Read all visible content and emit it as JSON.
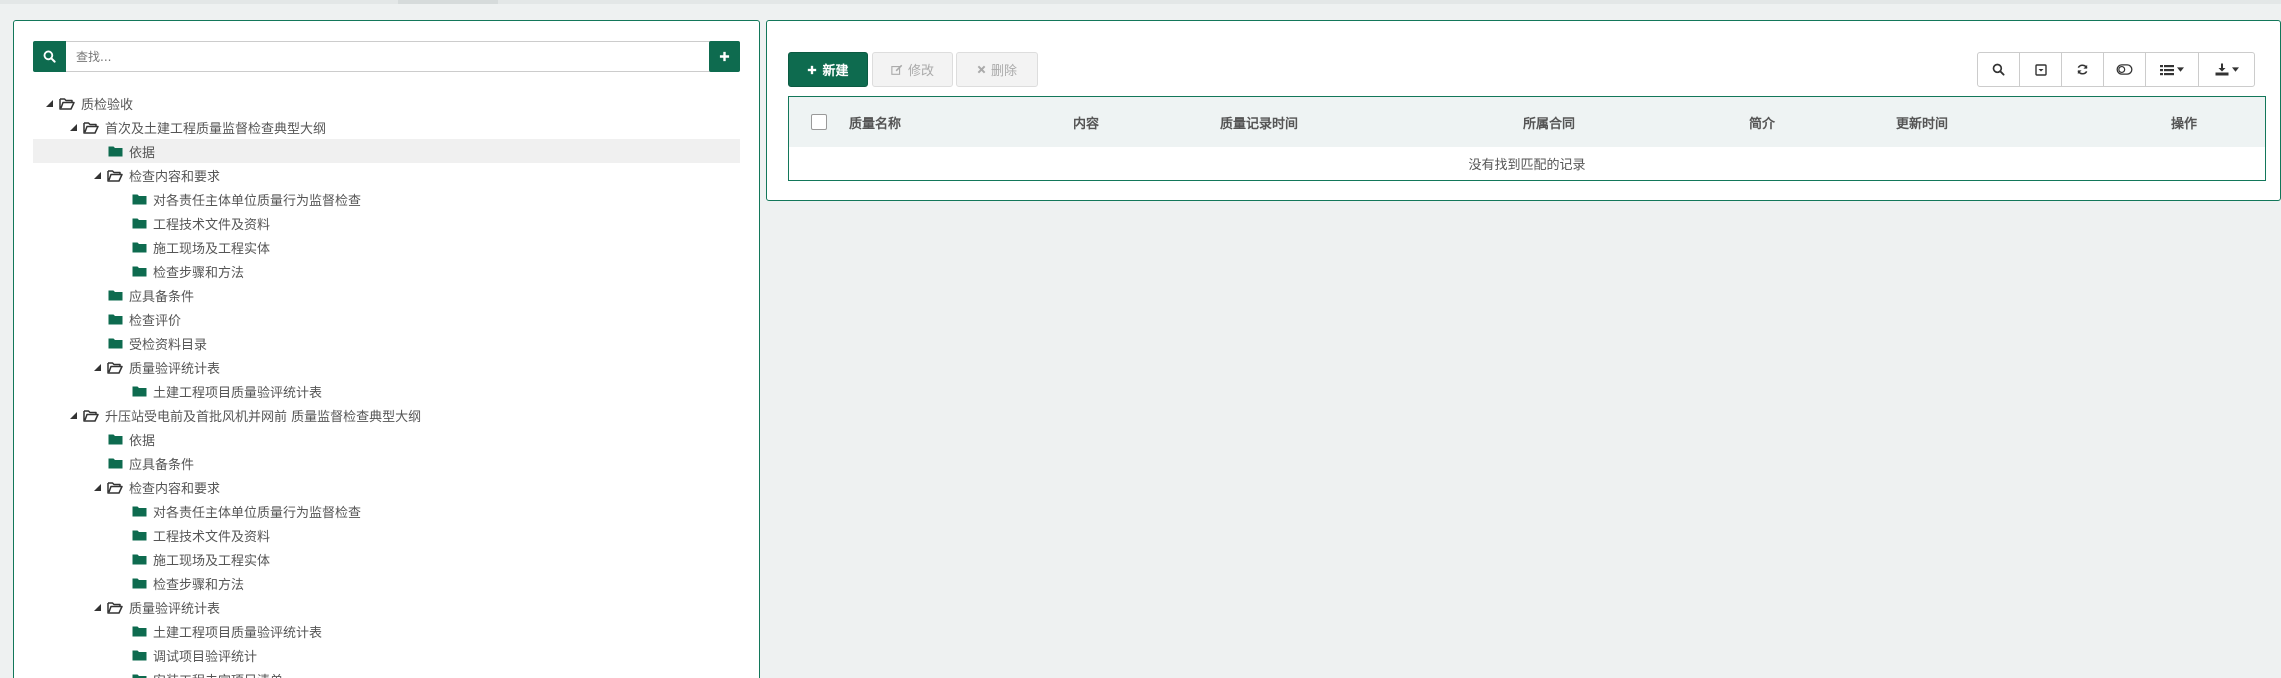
{
  "search": {
    "placeholder": "查找..."
  },
  "tree": [
    {
      "label": "质检验收",
      "level": 0,
      "caret": true,
      "open": true
    },
    {
      "label": "首次及土建工程质量监督检查典型大纲",
      "level": 1,
      "caret": true,
      "open": true
    },
    {
      "label": "依据",
      "level": 2,
      "caret": false,
      "open": false,
      "selected": true
    },
    {
      "label": "检查内容和要求",
      "level": 2,
      "caret": true,
      "open": true
    },
    {
      "label": "对各责任主体单位质量行为监督检查",
      "level": 3,
      "caret": false,
      "open": false
    },
    {
      "label": "工程技术文件及资料",
      "level": 3,
      "caret": false,
      "open": false
    },
    {
      "label": "施工现场及工程实体",
      "level": 3,
      "caret": false,
      "open": false
    },
    {
      "label": "检查步骤和方法",
      "level": 3,
      "caret": false,
      "open": false
    },
    {
      "label": "应具备条件",
      "level": 2,
      "caret": false,
      "open": false
    },
    {
      "label": "检查评价",
      "level": 2,
      "caret": false,
      "open": false
    },
    {
      "label": "受检资料目录",
      "level": 2,
      "caret": false,
      "open": false
    },
    {
      "label": "质量验评统计表",
      "level": 2,
      "caret": true,
      "open": true
    },
    {
      "label": "土建工程项目质量验评统计表",
      "level": 3,
      "caret": false,
      "open": false
    },
    {
      "label": "升压站受电前及首批风机并网前 质量监督检查典型大纲",
      "level": 1,
      "caret": true,
      "open": true
    },
    {
      "label": "依据",
      "level": 2,
      "caret": false,
      "open": false
    },
    {
      "label": "应具备条件",
      "level": 2,
      "caret": false,
      "open": false
    },
    {
      "label": "检查内容和要求",
      "level": 2,
      "caret": true,
      "open": true
    },
    {
      "label": "对各责任主体单位质量行为监督检查",
      "level": 3,
      "caret": false,
      "open": false
    },
    {
      "label": "工程技术文件及资料",
      "level": 3,
      "caret": false,
      "open": false
    },
    {
      "label": "施工现场及工程实体",
      "level": 3,
      "caret": false,
      "open": false
    },
    {
      "label": "检查步骤和方法",
      "level": 3,
      "caret": false,
      "open": false
    },
    {
      "label": "质量验评统计表",
      "level": 2,
      "caret": true,
      "open": true
    },
    {
      "label": "土建工程项目质量验评统计表",
      "level": 3,
      "caret": false,
      "open": false
    },
    {
      "label": "调试项目验评统计",
      "level": 3,
      "caret": false,
      "open": false
    },
    {
      "label": "安装工程未完项目清单",
      "level": 3,
      "caret": false,
      "open": false
    }
  ],
  "toolbar": {
    "new_label": "新建",
    "edit_label": "修改",
    "delete_label": "删除"
  },
  "table": {
    "columns": [
      "质量名称",
      "内容",
      "质量记录时间",
      "所属合同",
      "简介",
      "更新时间",
      "操作"
    ],
    "empty_text": "没有找到匹配的记录"
  },
  "colors": {
    "primary": "#0e6b4f",
    "border": "#13775a",
    "background": "#eef1f1"
  }
}
